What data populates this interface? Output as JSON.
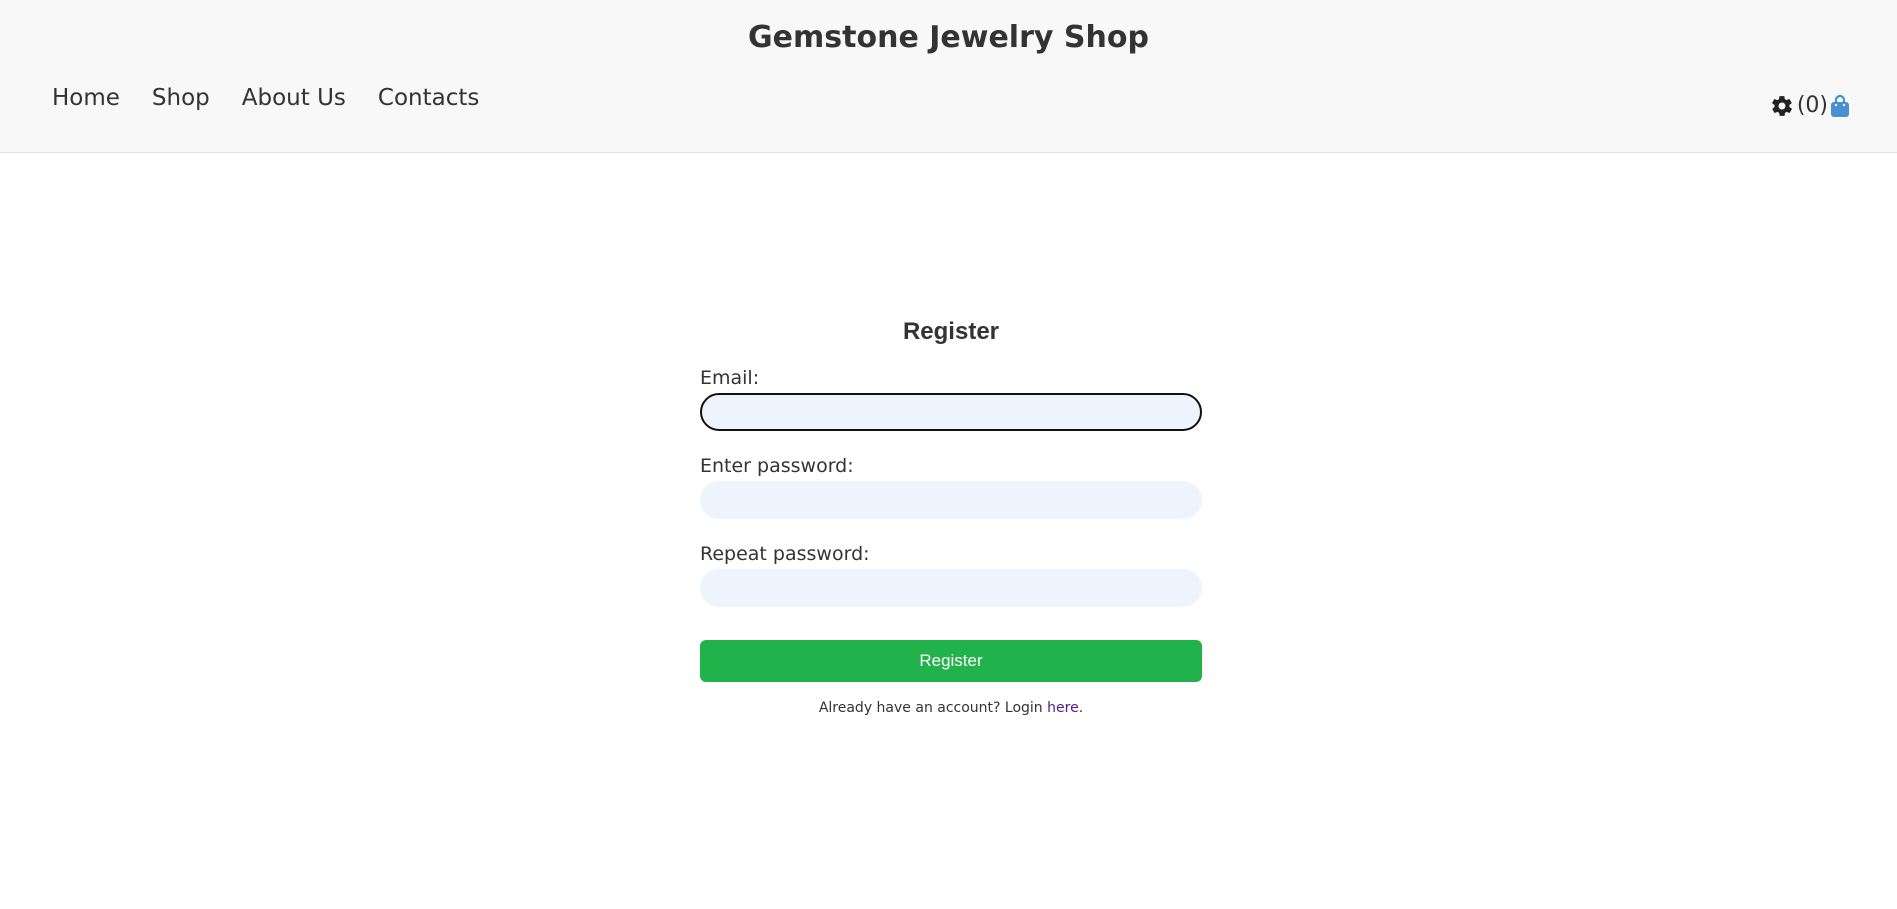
{
  "header": {
    "title": "Gemstone Jewelry Shop",
    "nav": [
      {
        "label": "Home"
      },
      {
        "label": "Shop"
      },
      {
        "label": "About Us"
      },
      {
        "label": "Contacts"
      }
    ],
    "cart_count": "(0)",
    "icons": {
      "settings": "gear-icon",
      "cart": "shopping-bag-icon"
    }
  },
  "form": {
    "title": "Register",
    "email_label": "Email:",
    "email_value": "",
    "password_label": "Enter password:",
    "password_value": "",
    "repeat_label": "Repeat password:",
    "repeat_value": "",
    "submit_label": "Register",
    "login_text": "Already have an account? Login",
    "login_link": "here",
    "login_end": "."
  },
  "colors": {
    "header_bg": "#f8f8f8",
    "input_bg": "#eef4fd",
    "submit_bg": "#22b24c",
    "cart_icon": "#4a8fd6",
    "link": "#551a8b"
  }
}
